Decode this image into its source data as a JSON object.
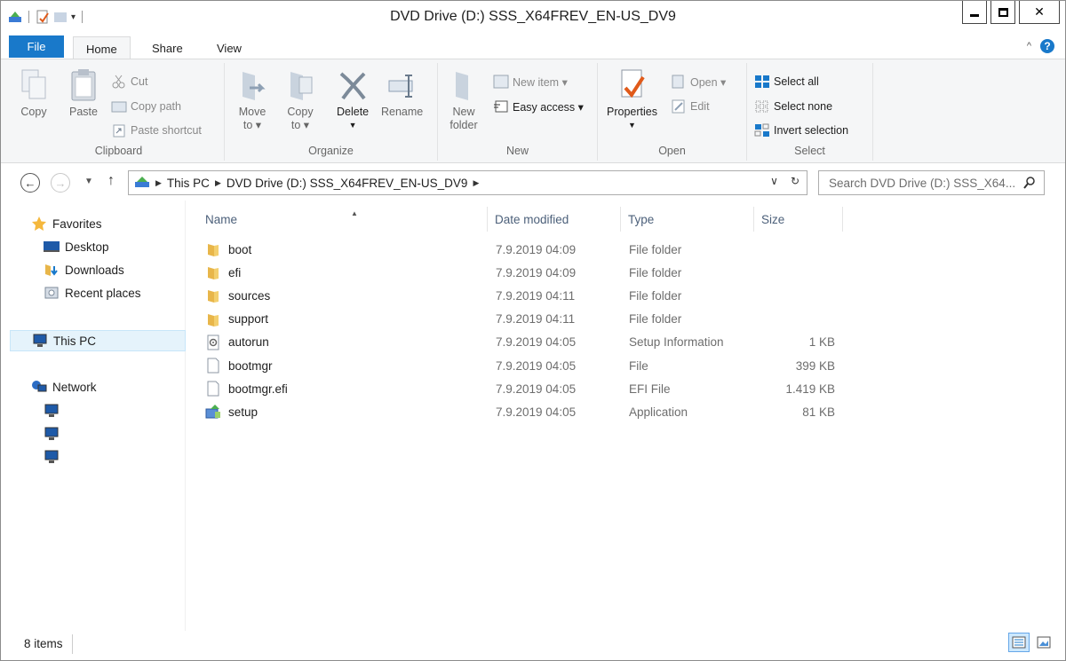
{
  "window": {
    "title": "DVD Drive (D:) SSS_X64FREV_EN-US_DV9"
  },
  "tabs": {
    "file": "File",
    "home": "Home",
    "share": "Share",
    "view": "View"
  },
  "ribbon": {
    "clipboard": {
      "label": "Clipboard",
      "copy": "Copy",
      "paste": "Paste",
      "cut": "Cut",
      "copy_path": "Copy path",
      "paste_shortcut": "Paste shortcut"
    },
    "organize": {
      "label": "Organize",
      "move_to": "Move",
      "move_to2": "to ▾",
      "copy_to": "Copy",
      "copy_to2": "to ▾",
      "delete": "Delete",
      "rename": "Rename"
    },
    "new": {
      "label": "New",
      "new_folder": "New",
      "new_folder2": "folder",
      "new_item": "New item ▾",
      "easy_access": "Easy access ▾"
    },
    "open": {
      "label": "Open",
      "properties": "Properties",
      "open_btn": "Open ▾",
      "edit": "Edit"
    },
    "select": {
      "label": "Select",
      "select_all": "Select all",
      "select_none": "Select none",
      "invert": "Invert selection"
    }
  },
  "address": {
    "segments": [
      "This PC",
      "DVD Drive (D:) SSS_X64FREV_EN-US_DV9"
    ]
  },
  "search": {
    "placeholder": "Search DVD Drive (D:) SSS_X64..."
  },
  "navpane": {
    "favorites": "Favorites",
    "desktop": "Desktop",
    "downloads": "Downloads",
    "recent": "Recent places",
    "thispc": "This PC",
    "network": "Network"
  },
  "columns": {
    "name": "Name",
    "date": "Date modified",
    "type": "Type",
    "size": "Size"
  },
  "files": [
    {
      "name": "boot",
      "date": "7.9.2019 04:09",
      "type": "File folder",
      "size": "",
      "icon": "folder-icon"
    },
    {
      "name": "efi",
      "date": "7.9.2019 04:09",
      "type": "File folder",
      "size": "",
      "icon": "folder-icon"
    },
    {
      "name": "sources",
      "date": "7.9.2019 04:11",
      "type": "File folder",
      "size": "",
      "icon": "folder-icon"
    },
    {
      "name": "support",
      "date": "7.9.2019 04:11",
      "type": "File folder",
      "size": "",
      "icon": "folder-icon"
    },
    {
      "name": "autorun",
      "date": "7.9.2019 04:05",
      "type": "Setup Information",
      "size": "1 KB",
      "icon": "setup-info-icon"
    },
    {
      "name": "bootmgr",
      "date": "7.9.2019 04:05",
      "type": "File",
      "size": "399 KB",
      "icon": "file-icon"
    },
    {
      "name": "bootmgr.efi",
      "date": "7.9.2019 04:05",
      "type": "EFI File",
      "size": "1.419 KB",
      "icon": "file-icon"
    },
    {
      "name": "setup",
      "date": "7.9.2019 04:05",
      "type": "Application",
      "size": "81 KB",
      "icon": "setup-app-icon"
    }
  ],
  "status": {
    "count": "8 items"
  },
  "colors": {
    "accent": "#1979ca",
    "folder": "#e8b64a",
    "header_text": "#4c607a"
  }
}
